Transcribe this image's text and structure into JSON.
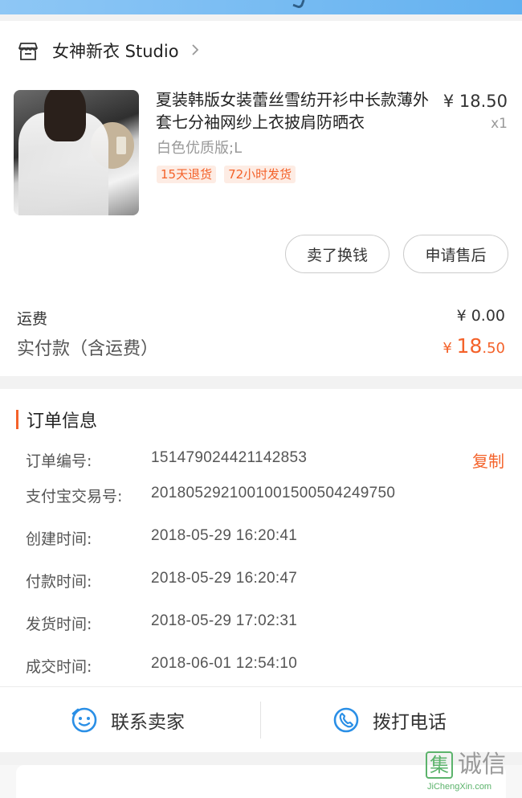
{
  "shop": {
    "name": "女神新衣 Studio",
    "icon": "shop-icon",
    "chevron": "chevron-right-icon"
  },
  "product": {
    "title": "夏装韩版女装蕾丝雪纺开衫中长款薄外套七分袖网纱上衣披肩防晒衣",
    "spec": "白色优质版;L",
    "tags": [
      "15天退货",
      "72小时发货"
    ],
    "price": "¥ 18.50",
    "qty": "x1"
  },
  "buttons": {
    "sell": "卖了换钱",
    "after_sales": "申请售后"
  },
  "summary": {
    "shipping_label": "运费",
    "shipping_value": "¥ 0.00",
    "paid_label": "实付款（含运费）",
    "paid_currency": "¥ ",
    "paid_int": "18",
    "paid_dec": ".50"
  },
  "order_info": {
    "title": "订单信息",
    "copy_label": "复制",
    "rows": [
      {
        "key": "订单编号:",
        "value": "151479024421142853"
      },
      {
        "key": "支付宝交易号:",
        "value": "2018052921001001500504249750"
      },
      {
        "key": "创建时间:",
        "value": "2018-05-29 16:20:41"
      },
      {
        "key": "付款时间:",
        "value": "2018-05-29 16:20:47"
      },
      {
        "key": "发货时间:",
        "value": "2018-05-29 17:02:31"
      },
      {
        "key": "成交时间:",
        "value": "2018-06-01 12:54:10"
      }
    ]
  },
  "actions": {
    "contact": {
      "label": "联系卖家",
      "icon": "chat-icon"
    },
    "call": {
      "label": "拨打电话",
      "icon": "phone-icon"
    }
  },
  "watermark": {
    "glyph": "集",
    "text": "诚信",
    "url": "JiChengXin.com"
  },
  "colors": {
    "accent": "#f4622a",
    "blue": "#2a8fe6",
    "watermark_green": "#5bb36b"
  }
}
